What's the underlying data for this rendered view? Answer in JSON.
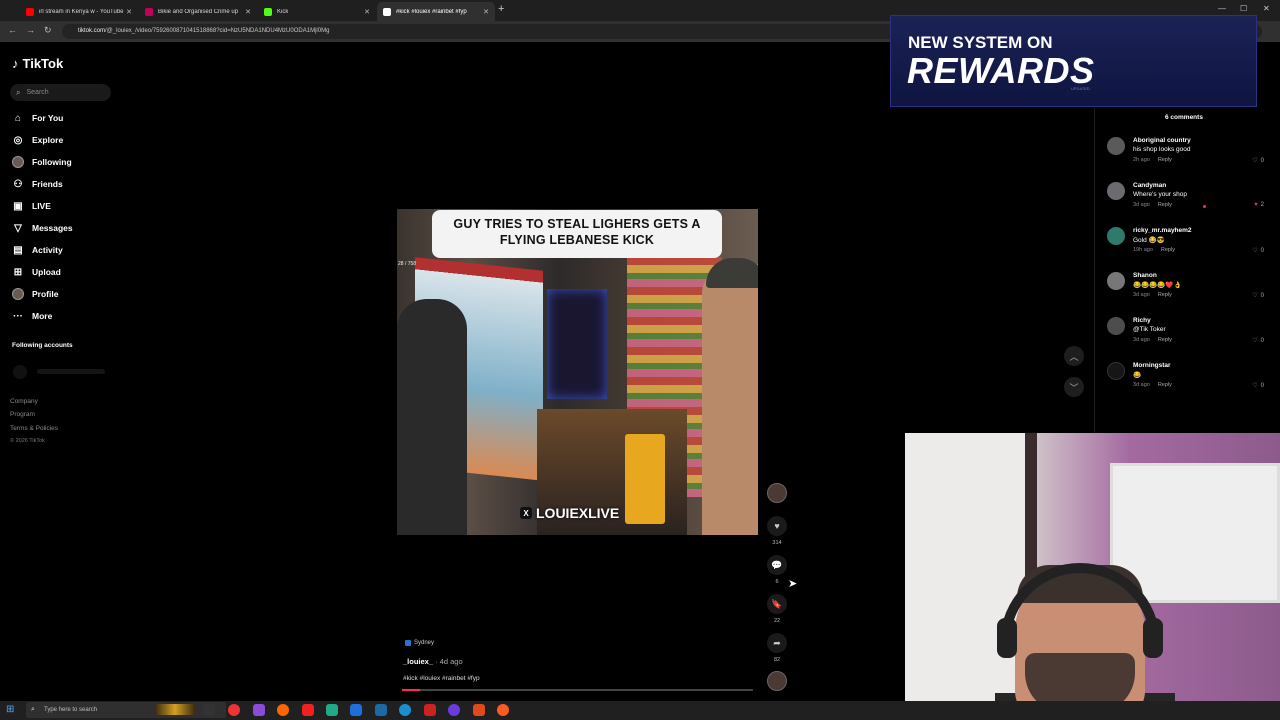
{
  "browser": {
    "tabs": [
      {
        "title": "irl stream in Kenya w - YouTube",
        "color": "#ff0000"
      },
      {
        "title": "Bikie and Organised Crime up",
        "color": "#c4005a"
      },
      {
        "title": "Kick",
        "color": "#53fc18"
      },
      {
        "title": "#kick #louiex #rainbet #fyp",
        "color": "#ffffff",
        "active": true
      }
    ],
    "url_host": "tiktok.com",
    "url_path": "/@_louiex_/video/7592600871041518868?cid=NzU5NDA1NDU4MzU0ODA1Mjl0Mg"
  },
  "sidebar": {
    "logo": "TikTok",
    "search_placeholder": "Search",
    "nav": [
      {
        "label": "For You",
        "icon": "home-icon"
      },
      {
        "label": "Explore",
        "icon": "compass-icon"
      },
      {
        "label": "Following",
        "icon": "avatar-icon"
      },
      {
        "label": "Friends",
        "icon": "users-icon"
      },
      {
        "label": "LIVE",
        "icon": "live-icon"
      },
      {
        "label": "Messages",
        "icon": "send-icon"
      },
      {
        "label": "Activity",
        "icon": "inbox-icon"
      },
      {
        "label": "Upload",
        "icon": "plus-square-icon"
      },
      {
        "label": "Profile",
        "icon": "profile-icon"
      },
      {
        "label": "More",
        "icon": "ellipsis-icon"
      }
    ],
    "following_accounts": "Following accounts",
    "footer": [
      "Company",
      "Program",
      "Terms & Policies"
    ],
    "copyright": "© 2026 TikTok"
  },
  "video": {
    "caption_line1": "GUY TRIES TO STEAL LIGHERS GETS A",
    "caption_line2": "FLYING LEBANESE KICK",
    "counter_tag": "28 / 758",
    "watermark": "LOUIEXLIVE",
    "location": "Sydney",
    "author": "_louiex_",
    "date": " · 4d ago",
    "hashtags": "#kick #louiex #rainbet #fyp",
    "progress": 0.05
  },
  "actions": {
    "likes": "314",
    "comments": "6",
    "saves": "22",
    "shares": "82"
  },
  "rewards": {
    "line1": "NEW SYSTEM ON",
    "line2": "REWARDS",
    "small": "UPDATED"
  },
  "comments": {
    "count": "6 comments",
    "items": [
      {
        "name": "Aboriginal country",
        "text": "his shop looks good",
        "time": "2h ago",
        "reply": "Reply",
        "likes": "0"
      },
      {
        "name": "Candyman",
        "text": "Where's your shop",
        "time": "3d ago",
        "reply": "Reply",
        "likes": "2",
        "liked": true
      },
      {
        "name": "ricky_mr.mayhem2",
        "text": "Gold 😂😎",
        "time": "19h ago",
        "reply": "Reply",
        "likes": "0"
      },
      {
        "name": "Shanon",
        "text": "😂😂😂😂❤️👌",
        "time": "3d ago",
        "reply": "Reply",
        "likes": "0"
      },
      {
        "name": "Richy",
        "text": "@Tik Toker",
        "time": "3d ago",
        "reply": "Reply",
        "likes": "0"
      },
      {
        "name": "Morningstar",
        "text": "😂",
        "time": "3d ago",
        "reply": "Reply",
        "likes": "0"
      }
    ]
  },
  "taskbar": {
    "search_placeholder": "Type here to search"
  }
}
